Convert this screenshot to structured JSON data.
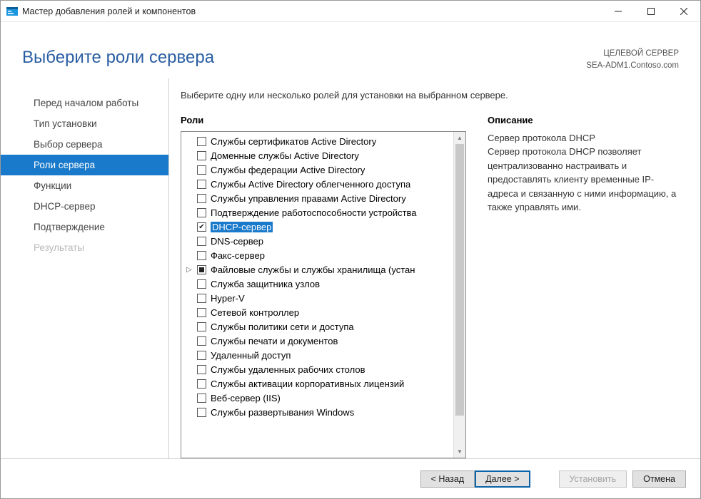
{
  "window": {
    "title": "Мастер добавления ролей и компонентов"
  },
  "header": {
    "title": "Выберите роли сервера",
    "target_label": "ЦЕЛЕВОЙ СЕРВЕР",
    "target_value": "SEA-ADM1.Contoso.com"
  },
  "sidebar": {
    "steps": [
      {
        "label": "Перед началом работы",
        "state": "normal"
      },
      {
        "label": "Тип установки",
        "state": "normal"
      },
      {
        "label": "Выбор сервера",
        "state": "normal"
      },
      {
        "label": "Роли сервера",
        "state": "active"
      },
      {
        "label": "Функции",
        "state": "normal"
      },
      {
        "label": "DHCP-сервер",
        "state": "normal"
      },
      {
        "label": "Подтверждение",
        "state": "normal"
      },
      {
        "label": "Результаты",
        "state": "disabled"
      }
    ]
  },
  "content": {
    "intro": "Выберите одну или несколько ролей для установки на выбранном сервере.",
    "roles_label": "Роли",
    "description_label": "Описание",
    "description_text": "Сервер протокола DHCP\nСервер протокола DHCP позволяет централизованно настраивать и предоставлять клиенту временные IP-адреса и связанную с ними информацию, а также управлять ими.",
    "roles": [
      {
        "label": "Службы сертификатов Active Directory",
        "check": "none"
      },
      {
        "label": "Доменные службы Active Directory",
        "check": "none"
      },
      {
        "label": "Службы федерации Active Directory",
        "check": "none"
      },
      {
        "label": "Службы Active Directory облегченного доступа",
        "check": "none"
      },
      {
        "label": "Службы управления правами Active Directory",
        "check": "none"
      },
      {
        "label": "Подтверждение работоспособности устройства",
        "check": "none"
      },
      {
        "label": "DHCP-сервер",
        "check": "checked",
        "selected": true
      },
      {
        "label": "DNS-сервер",
        "check": "none"
      },
      {
        "label": "Факс-сервер",
        "check": "none"
      },
      {
        "label": "Файловые службы и службы хранилища (устан",
        "check": "partial",
        "expandable": true
      },
      {
        "label": "Служба защитника узлов",
        "check": "none"
      },
      {
        "label": "Hyper-V",
        "check": "none"
      },
      {
        "label": "Сетевой контроллер",
        "check": "none"
      },
      {
        "label": "Службы политики сети и доступа",
        "check": "none"
      },
      {
        "label": "Службы печати и документов",
        "check": "none"
      },
      {
        "label": "Удаленный доступ",
        "check": "none"
      },
      {
        "label": "Службы удаленных рабочих столов",
        "check": "none"
      },
      {
        "label": "Службы активации корпоративных лицензий",
        "check": "none"
      },
      {
        "label": "Веб-сервер (IIS)",
        "check": "none"
      },
      {
        "label": "Службы развертывания Windows",
        "check": "none"
      }
    ]
  },
  "footer": {
    "back": "< Назад",
    "next": "Далее >",
    "install": "Установить",
    "cancel": "Отмена"
  }
}
